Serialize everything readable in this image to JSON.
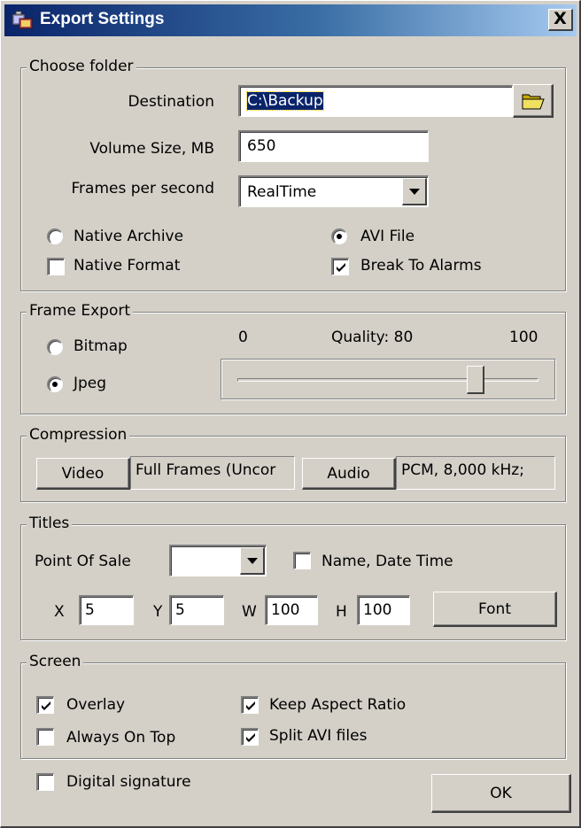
{
  "window": {
    "title": "Export Settings",
    "close_glyph": "X"
  },
  "choose_folder": {
    "title": "Choose folder",
    "destination_label": "Destination",
    "destination_value": "C:\\Backup",
    "folder_icon": "folder-open-icon",
    "volume_label": "Volume Size, MB",
    "volume_value": "650",
    "fps_label": "Frames per second",
    "fps_value": "RealTime",
    "native_archive": {
      "label": "Native Archive",
      "selected": false
    },
    "avi_file": {
      "label": "AVI File",
      "selected": true
    },
    "native_format": {
      "label": "Native Format",
      "checked": false
    },
    "break_to_alarms": {
      "label": "Break To Alarms",
      "checked": true
    }
  },
  "frame_export": {
    "title": "Frame Export",
    "bitmap": {
      "label": "Bitmap",
      "selected": false
    },
    "jpeg": {
      "label": "Jpeg",
      "selected": true
    },
    "quality_min": "0",
    "quality_max": "100",
    "quality_text": "Quality: 80",
    "quality_value": 80
  },
  "compression": {
    "title": "Compression",
    "video_button": "Video",
    "video_value": "Full Frames (Uncor",
    "audio_button": "Audio",
    "audio_value": "PCM, 8,000 kHz;"
  },
  "titles": {
    "title": "Titles",
    "pos_label": "Point Of Sale",
    "pos_value": "",
    "name_date_time": {
      "label": "Name, Date Time",
      "checked": false
    },
    "x_label": "X",
    "x_value": "5",
    "y_label": "Y",
    "y_value": "5",
    "w_label": "W",
    "w_value": "100",
    "h_label": "H",
    "h_value": "100",
    "font_button": "Font"
  },
  "screen": {
    "title": "Screen",
    "overlay": {
      "label": "Overlay",
      "checked": true
    },
    "always_on_top": {
      "label": "Always On Top",
      "checked": false
    },
    "keep_aspect_ratio": {
      "label": "Keep Aspect Ratio",
      "checked": true
    },
    "split_avi": {
      "label": "Split AVI files",
      "checked": true
    }
  },
  "digital_signature": {
    "label": "Digital signature",
    "checked": false
  },
  "ok_button": "OK",
  "colors": {
    "title_start": "#0a246a",
    "title_end": "#a6caf0",
    "face": "#d4d0c8",
    "selection": "#0a246a"
  }
}
